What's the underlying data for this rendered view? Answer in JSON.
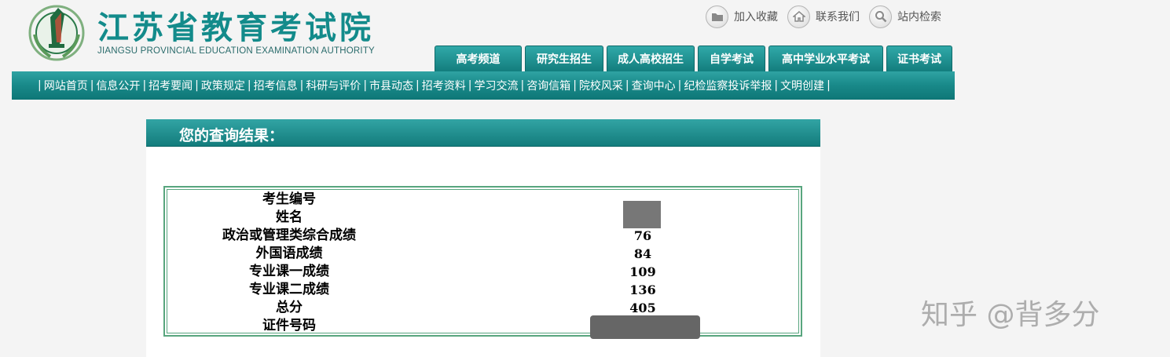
{
  "header": {
    "title_cn": "江苏省教育考试院",
    "title_en": "JIANGSU PROVINCIAL EDUCATION EXAMINATION AUTHORITY",
    "brand_color": "#138b8b"
  },
  "top_links": [
    {
      "label": "加入收藏",
      "icon": "folder-icon"
    },
    {
      "label": "联系我们",
      "icon": "home-icon"
    },
    {
      "label": "站内检索",
      "icon": "search-icon"
    }
  ],
  "tabs": [
    "高考频道",
    "研究生招生",
    "成人高校招生",
    "自学考试",
    "高中学业水平考试",
    "证书考试"
  ],
  "nav": [
    "网站首页",
    "信息公开",
    "招考要闻",
    "政策规定",
    "招考信息",
    "科研与评价",
    "市县动态",
    "招考资料",
    "学习交流",
    "咨询信箱",
    "院校风采",
    "查询中心",
    "纪检监察投诉举报",
    "文明创建"
  ],
  "result": {
    "title": "您的查询结果：",
    "rows": [
      {
        "label": "考生编号",
        "value": ""
      },
      {
        "label": "姓名",
        "value": ""
      },
      {
        "label": "政治或管理类综合成绩",
        "value": "76"
      },
      {
        "label": "外国语成绩",
        "value": "84"
      },
      {
        "label": "专业课一成绩",
        "value": "109"
      },
      {
        "label": "专业课二成绩",
        "value": "136"
      },
      {
        "label": "总分",
        "value": "405"
      },
      {
        "label": "证件号码",
        "value": ""
      }
    ]
  },
  "watermark": "知乎 @背多分"
}
